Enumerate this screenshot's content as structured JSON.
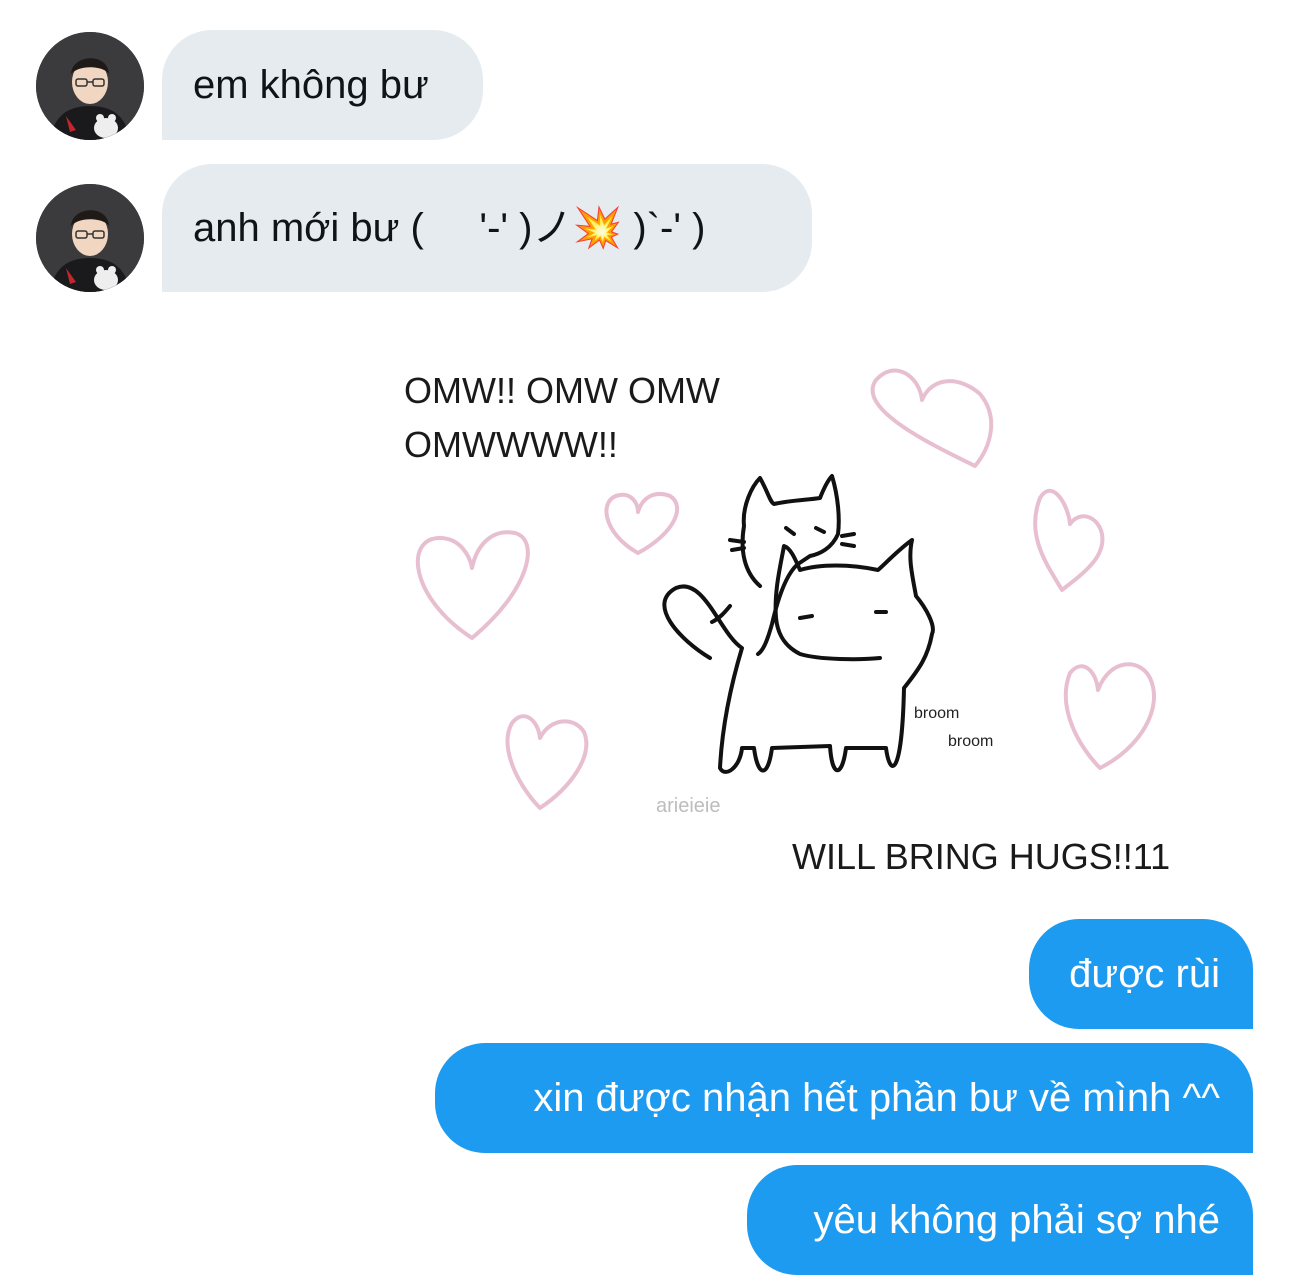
{
  "messages": {
    "incoming": [
      {
        "text": "em không bư"
      },
      {
        "text": "anh mới bư (     '-' )ノ💥 )`-' )"
      }
    ],
    "outgoing": [
      {
        "text": "được rùi"
      },
      {
        "text": "xin được nhận hết phần bư về mình ^^"
      },
      {
        "text": "yêu không phải sợ nhé"
      }
    ]
  },
  "media": {
    "headline_line1": "OMW!! OMW OMW",
    "headline_line2": "OMWWWW!!",
    "sound_1": "broom",
    "sound_2": "broom",
    "watermark": "arieieie",
    "caption": "WILL BRING HUGS!!11"
  },
  "colors": {
    "incoming_bubble": "#e6ebf0",
    "outgoing_bubble": "#1d9bf0",
    "heart": "#e7bfd0"
  },
  "icons": {
    "avatar": "user-avatar",
    "hearts": "heart-icon",
    "cats": "cat-drawing"
  }
}
